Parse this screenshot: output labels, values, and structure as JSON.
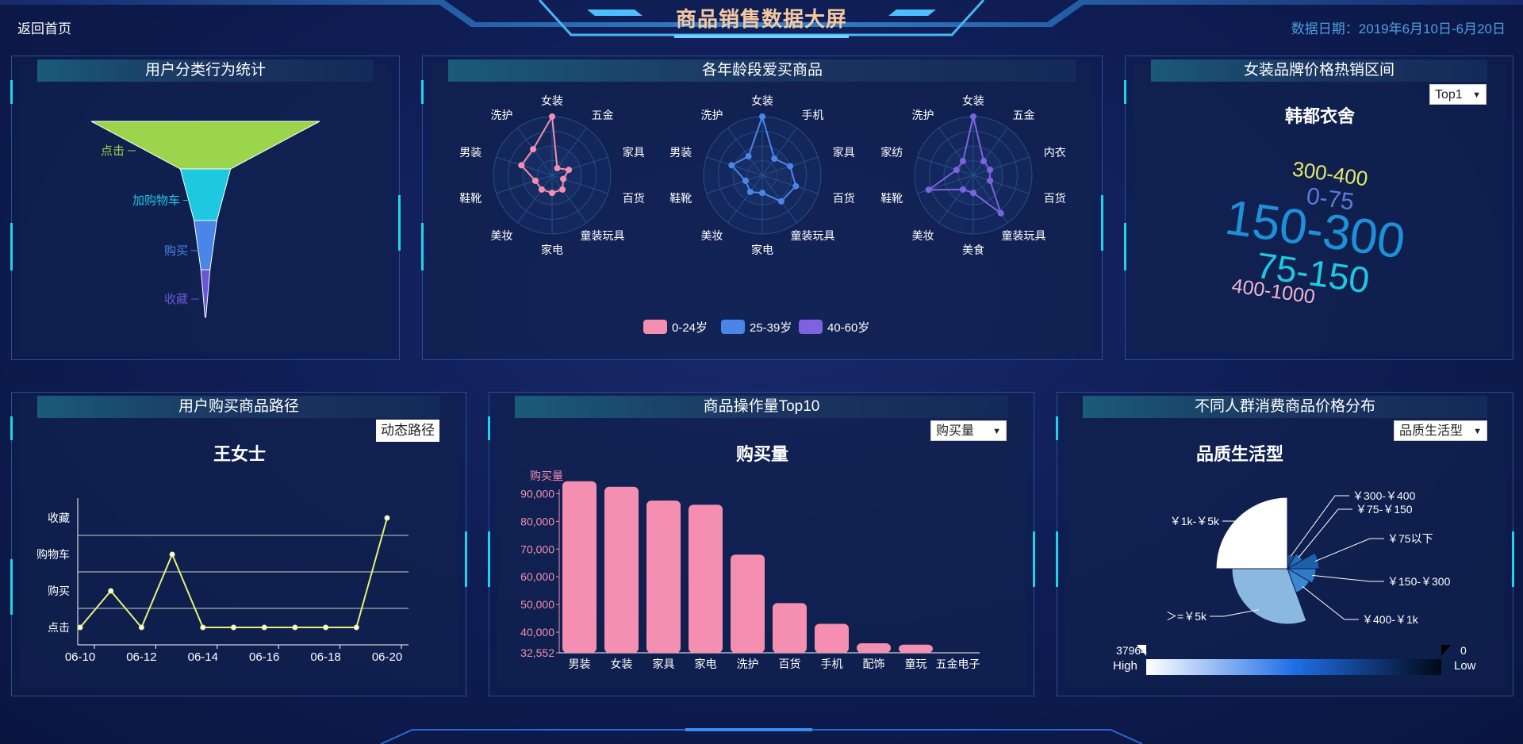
{
  "header": {
    "title": "商品销售数据大屏",
    "back_label": "返回首页",
    "date_label": "数据日期：2019年6月10日-6月20日"
  },
  "colors": {
    "accent": "#1fd4e8",
    "pink": "#f48fb1",
    "lime": "#a0e04a",
    "cyan": "#1ec8e0",
    "blue": "#4a86e8",
    "purple": "#7d63e0"
  },
  "funnel": {
    "title": "用户分类行为统计",
    "chart_data": {
      "type": "funnel",
      "stages": [
        "点击",
        "加购物车",
        "购买",
        "收藏"
      ],
      "values": [
        100,
        22,
        10,
        4
      ],
      "colors": [
        "#9ad54b",
        "#1ec8e0",
        "#4a86e8",
        "#6a55d6"
      ]
    }
  },
  "radar": {
    "title": "各年龄段爱买商品",
    "legend": [
      "0-24岁",
      "25-39岁",
      "40-60岁"
    ],
    "chart_data": [
      {
        "type": "radar",
        "series": "0-24岁",
        "color": "#f48fb1",
        "labels": [
          "女装",
          "五金",
          "家具",
          "百货",
          "童装玩具",
          "家电",
          "美妆",
          "鞋靴",
          "男装",
          "洗护"
        ],
        "values": [
          1.0,
          0.15,
          0.3,
          0.2,
          0.3,
          0.3,
          0.3,
          0.3,
          0.55,
          0.55
        ]
      },
      {
        "type": "radar",
        "series": "25-39岁",
        "color": "#4a86e8",
        "labels": [
          "女装",
          "手机",
          "家具",
          "百货",
          "童装玩具",
          "家电",
          "美妆",
          "鞋靴",
          "男装",
          "洗护"
        ],
        "values": [
          1.0,
          0.35,
          0.5,
          0.6,
          0.55,
          0.3,
          0.35,
          0.3,
          0.55,
          0.4
        ]
      },
      {
        "type": "radar",
        "series": "40-60岁",
        "color": "#7d63e0",
        "labels": [
          "女装",
          "五金",
          "内衣",
          "百货",
          "童装玩具",
          "美食",
          "美妆",
          "鞋靴",
          "家纺",
          "洗护"
        ],
        "values": [
          1.0,
          0.3,
          0.3,
          0.3,
          0.8,
          0.3,
          0.3,
          0.8,
          0.3,
          0.3
        ]
      }
    ]
  },
  "wordcloud": {
    "title": "女装品牌价格热销区间",
    "select": "Top1",
    "brand": "韩都衣舍",
    "words": [
      {
        "text": "150-300",
        "color": "#1e90d8"
      },
      {
        "text": "75-150",
        "color": "#1ec8e0"
      },
      {
        "text": "300-400",
        "color": "#e6e86a"
      },
      {
        "text": "0-75",
        "color": "#5a7ad8"
      },
      {
        "text": "400-1000",
        "color": "#f2b6cc"
      }
    ]
  },
  "path": {
    "title": "用户购买商品路径",
    "button": "动态路径",
    "user": "王女士",
    "chart_data": {
      "type": "line",
      "color": "#e6f07a",
      "x": [
        "06-10",
        "06-11",
        "06-12",
        "06-13",
        "06-14",
        "06-15",
        "06-16",
        "06-17",
        "06-18",
        "06-19",
        "06-20"
      ],
      "xticks": [
        "06-10",
        "06-12",
        "06-14",
        "06-16",
        "06-18",
        "06-20"
      ],
      "ycats": [
        "点击",
        "购买",
        "购物车",
        "收藏"
      ],
      "values": [
        0,
        1,
        0,
        2,
        0,
        0,
        0,
        0,
        0,
        0,
        3
      ]
    }
  },
  "top10": {
    "title": "商品操作量Top10",
    "select": "购买量",
    "subtitle": "购买量",
    "chart_data": {
      "type": "bar",
      "color": "#f48fb1",
      "ylabel": "购买量",
      "ylim": [
        32552,
        95000
      ],
      "yticks": [
        "32,552",
        "40,000",
        "50,000",
        "60,000",
        "70,000",
        "80,000",
        "90,000"
      ],
      "categories": [
        "男装",
        "女装",
        "家具",
        "家电",
        "洗护",
        "百货",
        "手机",
        "配饰",
        "童玩",
        "五金电子"
      ],
      "values": [
        94500,
        92500,
        87500,
        86000,
        68000,
        50500,
        43000,
        36000,
        35500,
        32552
      ]
    }
  },
  "pie": {
    "title": "不同人群消费商品价格分布",
    "select": "品质生活型",
    "subtitle": "品质生活型",
    "chart_data": {
      "type": "pie",
      "labels": [
        "￥1k-￥5k",
        "￥300-￥400",
        "￥75-￥150",
        "￥75以下",
        "￥150-￥300",
        "￥400-￥1k",
        "＞=￥5k"
      ],
      "values": [
        37964,
        600,
        900,
        1400,
        2800,
        5000,
        14000
      ]
    },
    "scale": {
      "max": "37964",
      "max_label": "High",
      "min": "0",
      "min_label": "Low"
    }
  }
}
